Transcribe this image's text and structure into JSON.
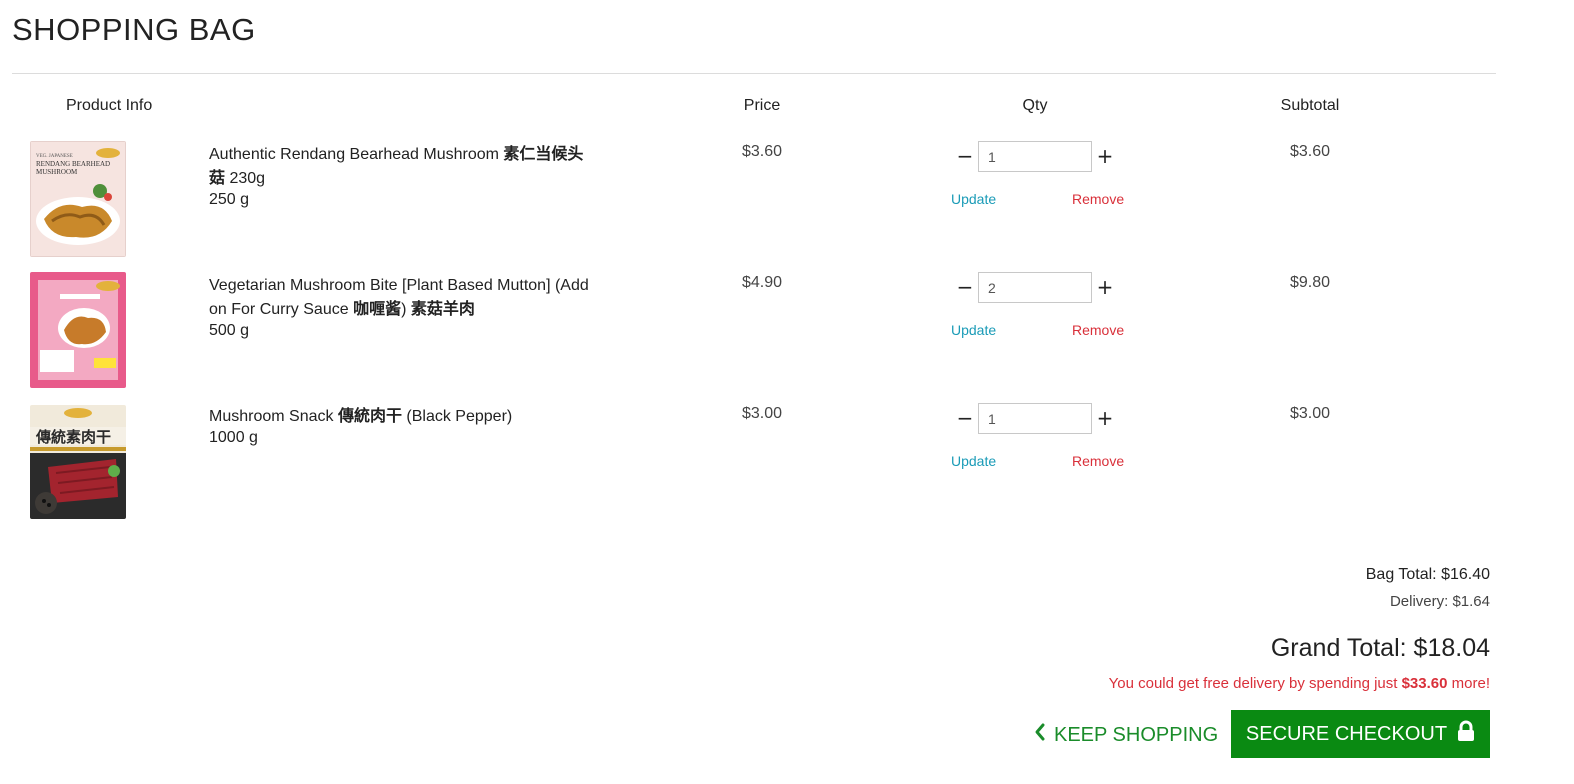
{
  "page": {
    "title": "SHOPPING BAG"
  },
  "columns": {
    "product": "Product Info",
    "price": "Price",
    "qty": "Qty",
    "subtotal": "Subtotal"
  },
  "items": [
    {
      "name": "Authentic Rendang Bearhead Mushroom ",
      "name_cn": "素仁当候头菇",
      "name_tail": " 230g",
      "size": "250 g",
      "price": "$3.60",
      "qty": "1",
      "subtotal": "$3.60",
      "update_label": "Update",
      "remove_label": "Remove"
    },
    {
      "name": "Vegetarian Mushroom Bite [Plant Based Mutton] (Add on For Curry Sauce ",
      "name_cn": "咖喱酱",
      "name_mid": ") ",
      "name_cn2": "素菇羊肉",
      "size": "500 g",
      "price": "$4.90",
      "qty": "2",
      "subtotal": "$9.80",
      "update_label": "Update",
      "remove_label": "Remove"
    },
    {
      "name": "Mushroom Snack ",
      "name_cn": "傳統肉干",
      "name_tail": " (Black Pepper)",
      "size": "1000 g",
      "price": "$3.00",
      "qty": "1",
      "subtotal": "$3.00",
      "update_label": "Update",
      "remove_label": "Remove"
    }
  ],
  "qty_controls": {
    "minus": "−",
    "plus": "+"
  },
  "summary": {
    "bag_total": "Bag Total: $16.40",
    "delivery": "Delivery: $1.64",
    "grand_total": "Grand Total: $18.04",
    "free_delivery_prefix": "You could get free delivery by spending just ",
    "free_delivery_amount": "$33.60",
    "free_delivery_suffix": " more!"
  },
  "actions": {
    "keep_shopping": "KEEP SHOPPING",
    "checkout": "SECURE CHECKOUT"
  },
  "colors": {
    "accent_green": "#0a8a12",
    "link_teal": "#1a9bb7",
    "alert_red": "#d9303a"
  },
  "icons": {
    "keep_shopping": "chevron-left-icon",
    "checkout": "lock-icon"
  },
  "thumbnail_text": {
    "item1": [
      "VEG. JAPANESE",
      "RENDANG BEARHEAD",
      "MUSHROOM"
    ],
    "item3": "傳統素肉干"
  }
}
